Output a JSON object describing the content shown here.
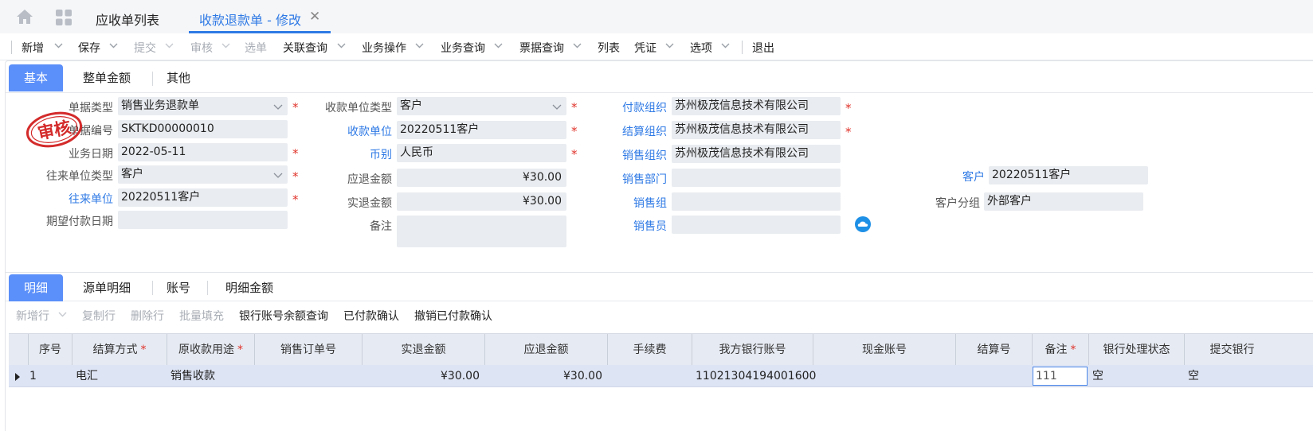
{
  "page_tabs": {
    "list_tab": "应收单列表",
    "active_tab": "收款退款单 - 修改"
  },
  "toolbar": {
    "items": [
      {
        "label": "新增",
        "dropdown": true,
        "disabled": false
      },
      {
        "label": "保存",
        "dropdown": true,
        "disabled": false
      },
      {
        "label": "提交",
        "dropdown": true,
        "disabled": true
      },
      {
        "label": "审核",
        "dropdown": true,
        "disabled": true
      },
      {
        "label": "选单",
        "dropdown": false,
        "disabled": true
      },
      {
        "label": "关联查询",
        "dropdown": true,
        "disabled": false
      },
      {
        "label": "业务操作",
        "dropdown": true,
        "disabled": false
      },
      {
        "label": "业务查询",
        "dropdown": true,
        "disabled": false
      },
      {
        "label": "票据查询",
        "dropdown": true,
        "disabled": false
      },
      {
        "label": "列表",
        "dropdown": false,
        "disabled": false
      },
      {
        "label": "凭证",
        "dropdown": true,
        "disabled": false
      },
      {
        "label": "选项",
        "dropdown": true,
        "disabled": false
      },
      {
        "label": "退出",
        "dropdown": false,
        "disabled": false
      }
    ]
  },
  "header_tabs": [
    "基本",
    "整单金额",
    "其他"
  ],
  "stamp_text": "审核",
  "form": {
    "bill_type": {
      "label": "单据类型",
      "value": "销售业务退款单"
    },
    "bill_no": {
      "label": "单据编号",
      "value": "SKTKD00000010"
    },
    "biz_date": {
      "label": "业务日期",
      "value": "2022-05-11"
    },
    "contact_type": {
      "label": "往来单位类型",
      "value": "客户"
    },
    "contact_unit": {
      "label": "往来单位",
      "value": "20220511客户"
    },
    "expected_pay_date": {
      "label": "期望付款日期",
      "value": ""
    },
    "recv_unit_type": {
      "label": "收款单位类型",
      "value": "客户"
    },
    "recv_unit": {
      "label": "收款单位",
      "value": "20220511客户"
    },
    "currency": {
      "label": "币别",
      "value": "人民币"
    },
    "refund_due": {
      "label": "应退金额",
      "value": "¥30.00"
    },
    "refund_actual": {
      "label": "实退金额",
      "value": "¥30.00"
    },
    "remark": {
      "label": "备注",
      "value": ""
    },
    "pay_org": {
      "label": "付款组织",
      "value": "苏州极茂信息技术有限公司"
    },
    "settle_org": {
      "label": "结算组织",
      "value": "苏州极茂信息技术有限公司"
    },
    "sale_org": {
      "label": "销售组织",
      "value": "苏州极茂信息技术有限公司"
    },
    "sale_dept": {
      "label": "销售部门",
      "value": ""
    },
    "sale_group": {
      "label": "销售组",
      "value": ""
    },
    "salesperson": {
      "label": "销售员",
      "value": ""
    },
    "customer": {
      "label": "客户",
      "value": "20220511客户"
    },
    "customer_group": {
      "label": "客户分组",
      "value": "外部客户"
    }
  },
  "detail_tabs": [
    "明细",
    "源单明细",
    "账号",
    "明细金额"
  ],
  "detail_toolbar": [
    {
      "label": "新增行",
      "disabled": true,
      "dropdown": true
    },
    {
      "label": "复制行",
      "disabled": true
    },
    {
      "label": "删除行",
      "disabled": true
    },
    {
      "label": "批量填充",
      "disabled": true
    },
    {
      "label": "银行账号余额查询",
      "disabled": false
    },
    {
      "label": "已付款确认",
      "disabled": false
    },
    {
      "label": "撤销已付款确认",
      "disabled": false
    }
  ],
  "grid": {
    "columns": [
      "序号",
      "结算方式",
      "原收款用途",
      "销售订单号",
      "实退金额",
      "应退金额",
      "手续费",
      "我方银行账号",
      "现金账号",
      "结算号",
      "备注",
      "银行处理状态",
      "提交银行"
    ],
    "rows": [
      [
        "1",
        "电汇",
        "销售收款",
        "",
        "¥30.00",
        "¥30.00",
        "",
        "11021304194001600",
        "",
        "",
        "111",
        "空",
        "空"
      ]
    ]
  },
  "colors": {
    "accent": "#2f7ae5",
    "tab_active_bg": "#5b8ff9",
    "required": "#e0332b",
    "stamp": "#d42b2b"
  }
}
